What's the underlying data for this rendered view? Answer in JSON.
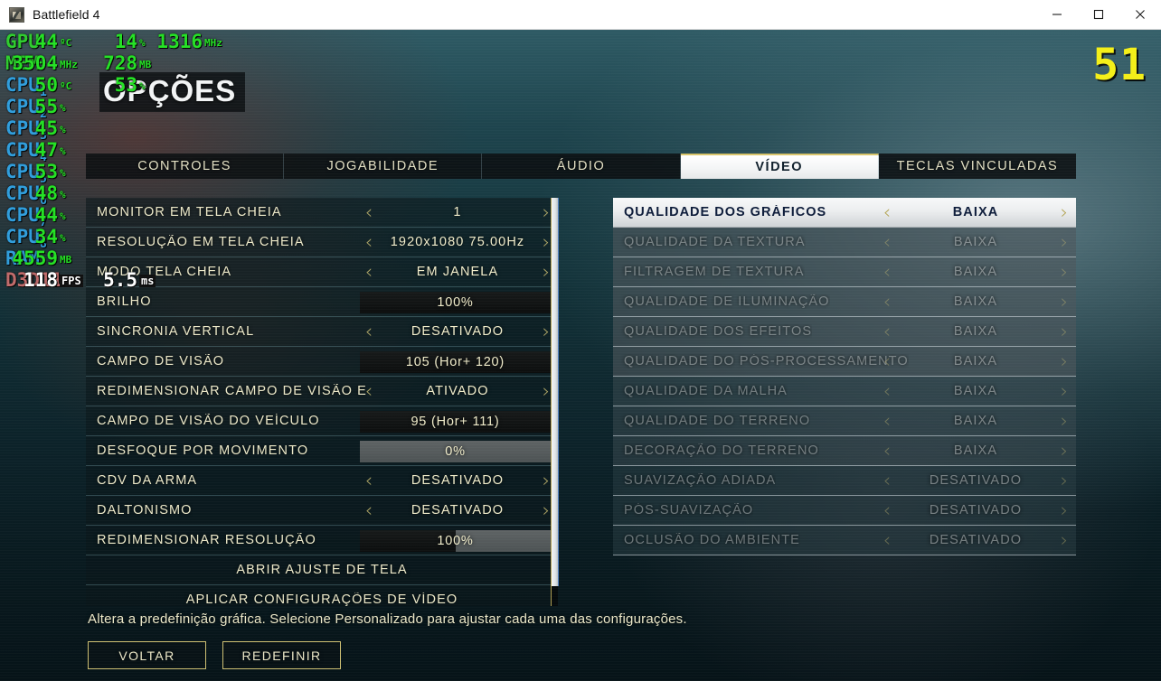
{
  "window": {
    "title": "Battlefield 4",
    "icon": "app-icon",
    "minimize_label": "–",
    "maximize_label": "□",
    "close_label": "✕"
  },
  "osd": {
    "fps_big": "51",
    "rows": [
      {
        "label": "GPU",
        "sub": "",
        "type": "gpu",
        "fields": [
          {
            "value": "44",
            "unit": "ºC"
          },
          {
            "value": "14",
            "unit": "%"
          },
          {
            "value": "1316",
            "unit": "MHz"
          }
        ]
      },
      {
        "label": "MEM",
        "sub": "",
        "type": "gpu",
        "fields": [
          {
            "value": "3504",
            "unit": "MHz"
          },
          {
            "value": "728",
            "unit": "MB"
          }
        ]
      },
      {
        "label": "CPU",
        "sub": "1",
        "type": "cpu",
        "fields": [
          {
            "value": "50",
            "unit": "ºC"
          },
          {
            "value": "53",
            "unit": "%"
          }
        ]
      },
      {
        "label": "CPU",
        "sub": "2",
        "type": "cpu",
        "fields": [
          {
            "value": "55",
            "unit": "%"
          }
        ]
      },
      {
        "label": "CPU",
        "sub": "3",
        "type": "cpu",
        "fields": [
          {
            "value": "45",
            "unit": "%"
          }
        ]
      },
      {
        "label": "CPU",
        "sub": "4",
        "type": "cpu",
        "fields": [
          {
            "value": "47",
            "unit": "%"
          }
        ]
      },
      {
        "label": "CPU",
        "sub": "5",
        "type": "cpu",
        "fields": [
          {
            "value": "53",
            "unit": "%"
          }
        ]
      },
      {
        "label": "CPU",
        "sub": "6",
        "type": "cpu",
        "fields": [
          {
            "value": "48",
            "unit": "%"
          }
        ]
      },
      {
        "label": "CPU",
        "sub": "7",
        "type": "cpu",
        "fields": [
          {
            "value": "44",
            "unit": "%"
          }
        ]
      },
      {
        "label": "CPU",
        "sub": "8",
        "type": "cpu",
        "fields": [
          {
            "value": "34",
            "unit": "%"
          }
        ]
      },
      {
        "label": "RAM",
        "sub": "",
        "type": "ram",
        "fields": [
          {
            "value": "4559",
            "unit": "MB"
          }
        ]
      },
      {
        "label": "D3D11",
        "sub": "",
        "type": "d3d",
        "fields": [
          {
            "value": "118",
            "unit": "FPS",
            "white": true,
            "chip": true
          },
          {
            "value": "5.5",
            "unit": "ms",
            "white": true,
            "chip": true
          }
        ]
      }
    ],
    "colors": {
      "green": "#24e024",
      "blue": "#2f9ddb",
      "red": "#c06a6a",
      "yellow": "#f4ef18",
      "white": "#ffffff"
    }
  },
  "menu": {
    "title": "OPÇÕES",
    "tabs": [
      {
        "label": "CONTROLES",
        "active": false
      },
      {
        "label": "JOGABILIDADE",
        "active": false
      },
      {
        "label": "ÁUDIO",
        "active": false
      },
      {
        "label": "VÍDEO",
        "active": true
      },
      {
        "label": "TECLAS VINCULADAS",
        "active": false
      }
    ],
    "left_settings": [
      {
        "label": "MONITOR EM TELA CHEIA",
        "value": "1",
        "control": "stepper"
      },
      {
        "label": "RESOLUÇÃO EM TELA CHEIA",
        "value": "1920x1080 75.00Hz",
        "control": "stepper"
      },
      {
        "label": "MODO TELA CHEIA",
        "value": "EM JANELA",
        "control": "stepper"
      },
      {
        "label": "BRILHO",
        "value": "100%",
        "control": "slider",
        "fill": 100
      },
      {
        "label": "SINCRONIA VERTICAL",
        "value": "DESATIVADO",
        "control": "stepper"
      },
      {
        "label": "CAMPO DE VISÃO",
        "value": "105  (Hor+ 120)",
        "control": "slider",
        "fill": 100
      },
      {
        "label": "REDIMENSIONAR CAMPO DE VISÃO E",
        "value": "ATIVADO",
        "control": "stepper"
      },
      {
        "label": "CAMPO DE VISÃO DO VEÍCULO",
        "value": "95  (Hor+ 111)",
        "control": "slider",
        "fill": 100
      },
      {
        "label": "DESFOQUE POR MOVIMENTO",
        "value": "0%",
        "control": "slider",
        "fill": 0
      },
      {
        "label": "CDV DA ARMA",
        "value": "DESATIVADO",
        "control": "stepper"
      },
      {
        "label": "DALTONISMO",
        "value": "DESATIVADO",
        "control": "stepper"
      },
      {
        "label": "REDIMENSIONAR RESOLUÇÃO",
        "value": "100%",
        "control": "slider",
        "fill": 50
      },
      {
        "label": "ABRIR AJUSTE DE TELA",
        "value": "",
        "control": "action"
      },
      {
        "label": "APLICAR CONFIGURAÇÕES DE VÍDEO",
        "value": "",
        "control": "action"
      }
    ],
    "right_settings": [
      {
        "label": "QUALIDADE DOS GRÁFICOS",
        "value": "BAIXA",
        "state": "selected"
      },
      {
        "label": "QUALIDADE DA TEXTURA",
        "value": "BAIXA",
        "state": "disabled"
      },
      {
        "label": "FILTRAGEM DE TEXTURA",
        "value": "BAIXA",
        "state": "disabled"
      },
      {
        "label": "QUALIDADE DE ILUMINAÇÃO",
        "value": "BAIXA",
        "state": "disabled"
      },
      {
        "label": "QUALIDADE DOS EFEITOS",
        "value": "BAIXA",
        "state": "disabled"
      },
      {
        "label": "QUALIDADE DO PÓS-PROCESSAMENTO",
        "value": "BAIXA",
        "state": "disabled"
      },
      {
        "label": "QUALIDADE DA MALHA",
        "value": "BAIXA",
        "state": "disabled"
      },
      {
        "label": "QUALIDADE DO TERRENO",
        "value": "BAIXA",
        "state": "disabled"
      },
      {
        "label": "DECORAÇÃO DO TERRENO",
        "value": "BAIXA",
        "state": "disabled"
      },
      {
        "label": "SUAVIZAÇÃO ADIADA",
        "value": "DESATIVADO",
        "state": "disabled"
      },
      {
        "label": "PÓS-SUAVIZAÇÃO",
        "value": "DESATIVADO",
        "state": "disabled"
      },
      {
        "label": "OCLUSÃO DO AMBIENTE",
        "value": "DESATIVADO",
        "state": "disabled"
      }
    ],
    "description": "Altera a predefinição gráfica. Selecione Personalizado para ajustar cada uma das configurações.",
    "buttons": [
      {
        "label": "VOLTAR"
      },
      {
        "label": "REDEFINIR"
      }
    ],
    "arrows": {
      "left": "‹",
      "right": "›"
    },
    "accent_gold": "#cdbf72",
    "selected_bg": "#f2f4f5"
  }
}
